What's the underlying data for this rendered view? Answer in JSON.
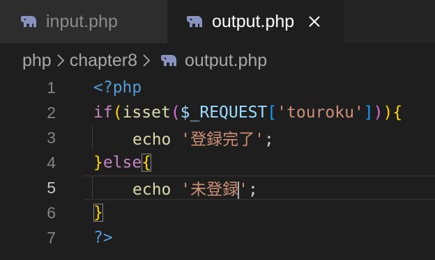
{
  "tabs": [
    {
      "label": "input.php",
      "icon": "php-elephant-icon",
      "active": false
    },
    {
      "label": "output.php",
      "icon": "php-elephant-icon",
      "active": true,
      "close_icon": "close-icon"
    }
  ],
  "breadcrumb": {
    "items": [
      "php",
      "chapter8",
      "output.php"
    ],
    "separator_icon": "chevron-right-icon",
    "file_icon": "php-elephant-icon"
  },
  "editor": {
    "line_numbers": [
      "1",
      "2",
      "3",
      "4",
      "5",
      "6",
      "7"
    ],
    "active_line": "5",
    "lines": [
      "<?php",
      "if(isset($_REQUEST['touroku'])){",
      "    echo '登録完了';",
      "}else{",
      "    echo '未登録';",
      "}",
      "?>"
    ],
    "tokens": {
      "open_tag": "<?php",
      "close_tag": "?>",
      "kw_if": "if",
      "kw_else": "else",
      "fn_isset": "isset",
      "var_request": "$_REQUEST",
      "str_touroku": "'touroku'",
      "fn_echo": "echo",
      "str_done": "'登録完了'",
      "str_not_q": "'未登録",
      "str_not_end": "'",
      "paren_open": "(",
      "paren_close": ")",
      "brace_open": "{",
      "brace_close": "}",
      "bracket_open": "[",
      "bracket_close": "]",
      "semicolon": ";"
    }
  },
  "colors": {
    "php_icon": "#8892bf",
    "keyword": "#c586c0",
    "function": "#dcdcaa",
    "variable": "#9cdcfe",
    "string": "#ce9178",
    "php_tag": "#569cd6"
  }
}
